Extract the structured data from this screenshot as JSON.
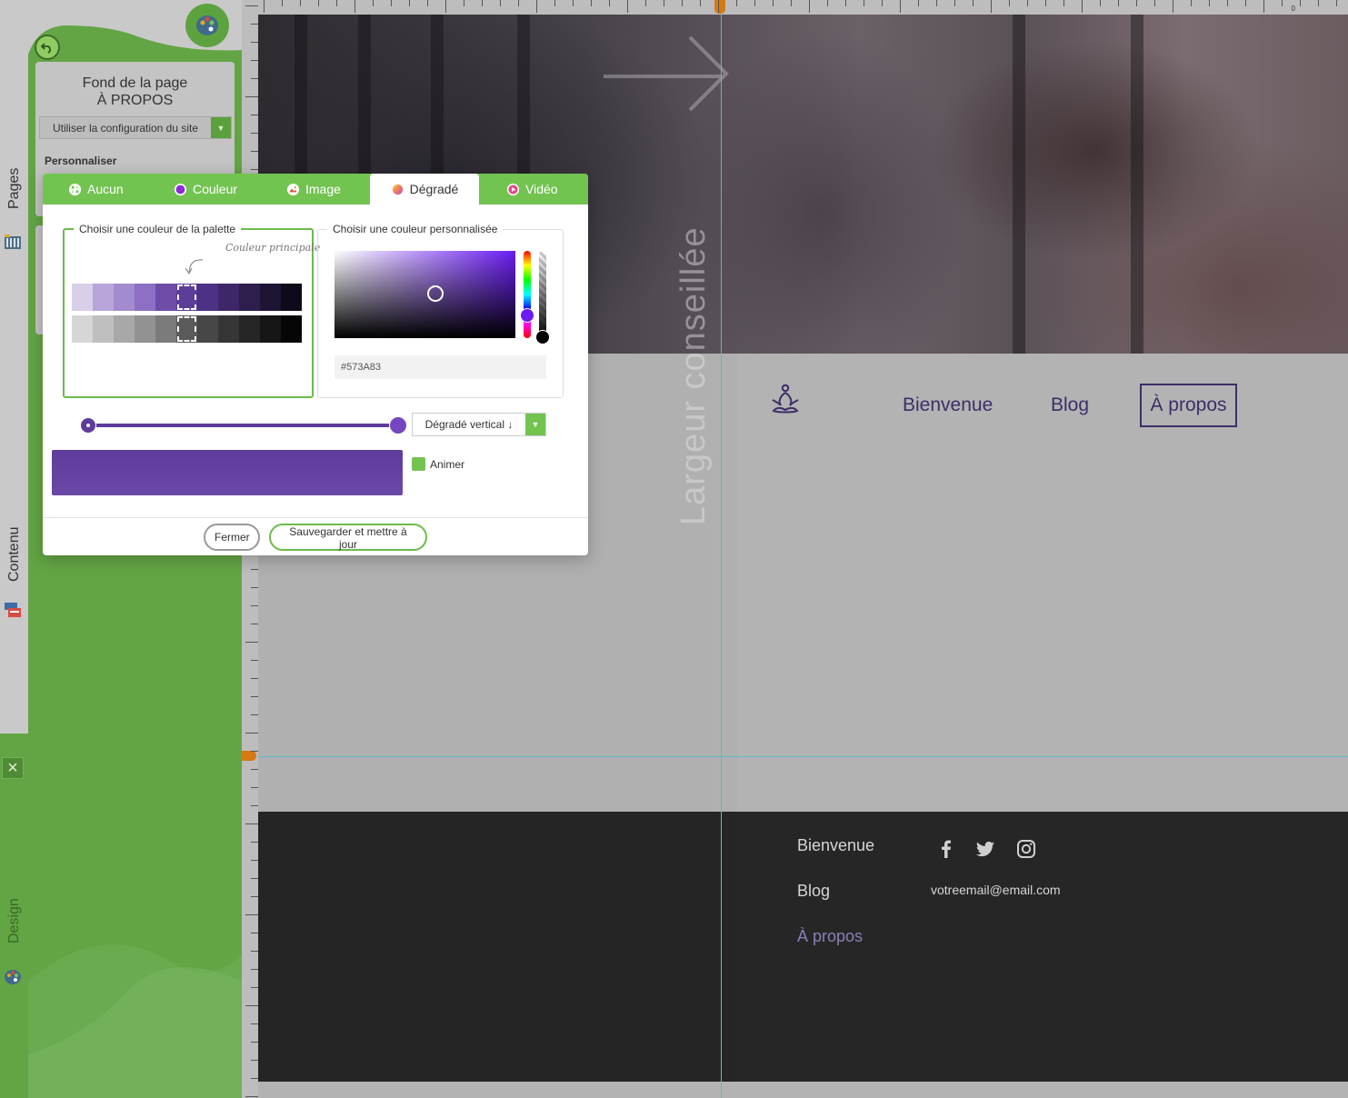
{
  "sidebar_tabs": {
    "pages": "Pages",
    "contenu": "Contenu",
    "design": "Design"
  },
  "panel": {
    "title_line1": "Fond de la page",
    "title_line2": "À PROPOS",
    "config_select": "Utiliser la configuration du site",
    "personaliser": "Personnaliser"
  },
  "modal": {
    "tabs": [
      {
        "label": "Aucun",
        "icon": "no-background-icon"
      },
      {
        "label": "Couleur",
        "icon": "color-circle-icon"
      },
      {
        "label": "Image",
        "icon": "image-icon"
      },
      {
        "label": "Dégradé",
        "icon": "gradient-icon"
      },
      {
        "label": "Vidéo",
        "icon": "video-play-icon"
      }
    ],
    "active_tab": "Dégradé",
    "palette_legend": "Choisir une couleur de la palette",
    "palette_hint": "Couleur principale",
    "palette_rows": [
      [
        "#d9cfe9",
        "#b8a5da",
        "#a38bcf",
        "#8d6fc3",
        "#6e4ca8",
        "#5c3d99",
        "#4d3185",
        "#3d2769",
        "#2d1e4d",
        "#1e1433",
        "#0f0a1a"
      ],
      [
        "#d6d6d6",
        "#bfbfbf",
        "#a8a8a8",
        "#929292",
        "#7b7b7b",
        "#5a5a5a",
        "#474747",
        "#363636",
        "#262626",
        "#161616",
        "#060606"
      ]
    ],
    "selected_swatch_index": 5,
    "custom_legend": "Choisir une couleur personnalisée",
    "hex_value": "#573A83",
    "gradient_type": "Dégradé vertical ↓",
    "animer": "Animer",
    "btn_close": "Fermer",
    "btn_save": "Sauvegarder et mettre à jour"
  },
  "preview": {
    "guide_label": "Largeur conseillée",
    "nav": [
      "Bienvenue",
      "Blog",
      "À propos"
    ],
    "footer_links": [
      "Bienvenue",
      "Blog",
      "À propos"
    ],
    "footer_email": "votreemail@email.com",
    "ruler_zero": "0"
  },
  "colors": {
    "accent_green": "#73c351",
    "panel_green": "#63a545",
    "brand_purple": "#3e2d68",
    "guide": "#5bbdc3",
    "ruler_marker": "#d37a12"
  }
}
